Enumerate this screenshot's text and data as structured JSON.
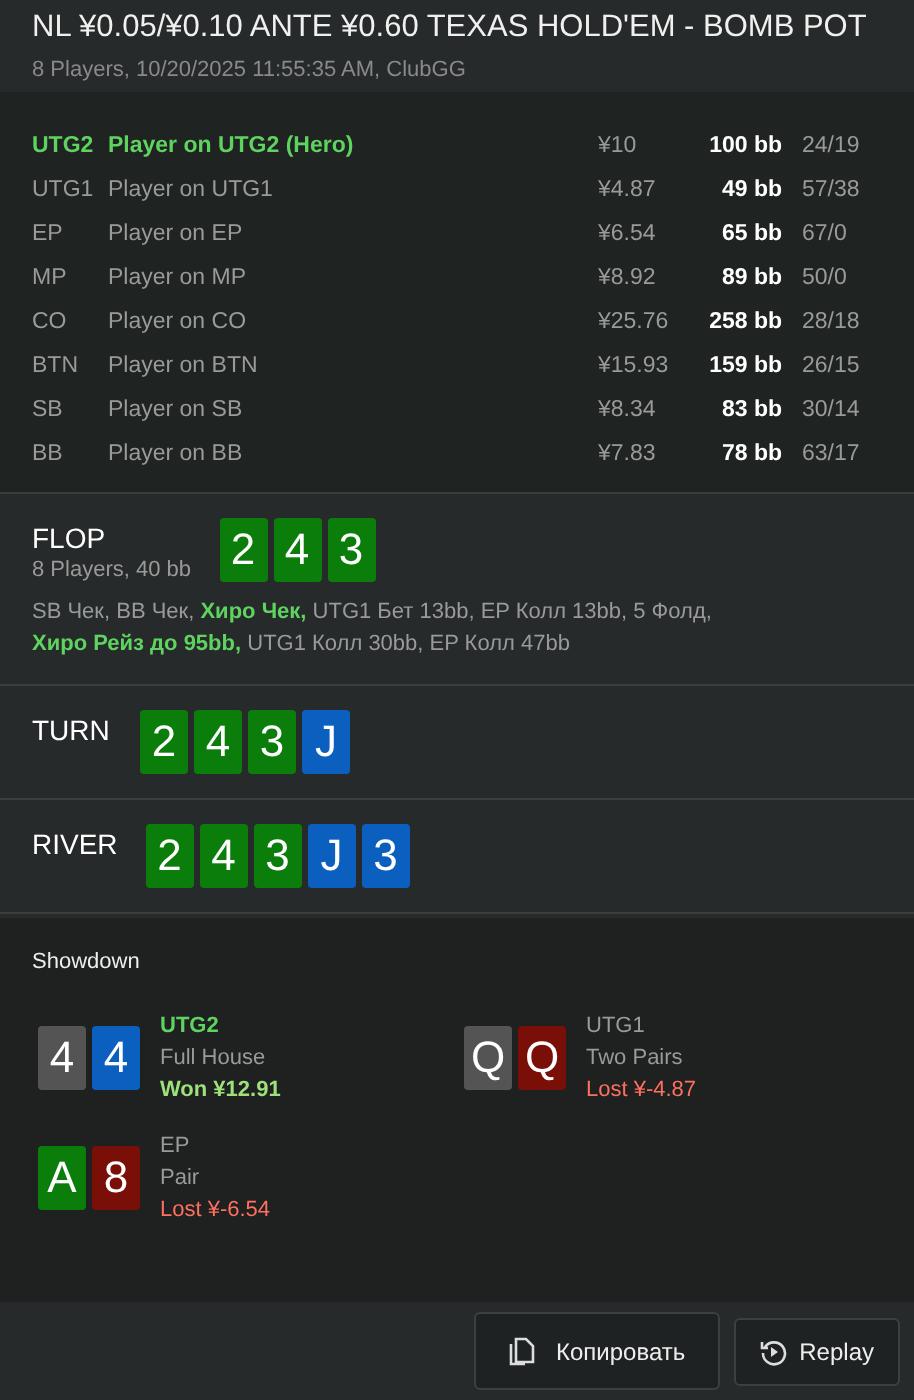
{
  "header": {
    "title": "NL ¥0.05/¥0.10 ANTE ¥0.60 TEXAS HOLD'EM - BOMB POT",
    "subtitle": "8 Players, 10/20/2025 11:55:35 AM, ClubGG"
  },
  "players": [
    {
      "position": "UTG2",
      "name": "Player on UTG2 (Hero)",
      "stack": "¥10",
      "bb": "100 bb",
      "stats": "24/19",
      "hero": true
    },
    {
      "position": "UTG1",
      "name": "Player on UTG1",
      "stack": "¥4.87",
      "bb": "49 bb",
      "stats": "57/38",
      "hero": false
    },
    {
      "position": "EP",
      "name": "Player on EP",
      "stack": "¥6.54",
      "bb": "65 bb",
      "stats": "67/0",
      "hero": false
    },
    {
      "position": "MP",
      "name": "Player on MP",
      "stack": "¥8.92",
      "bb": "89 bb",
      "stats": "50/0",
      "hero": false
    },
    {
      "position": "CO",
      "name": "Player on CO",
      "stack": "¥25.76",
      "bb": "258 bb",
      "stats": "28/18",
      "hero": false
    },
    {
      "position": "BTN",
      "name": "Player on BTN",
      "stack": "¥15.93",
      "bb": "159 bb",
      "stats": "26/15",
      "hero": false
    },
    {
      "position": "SB",
      "name": "Player on SB",
      "stack": "¥8.34",
      "bb": "83 bb",
      "stats": "30/14",
      "hero": false
    },
    {
      "position": "BB",
      "name": "Player on BB",
      "stack": "¥7.83",
      "bb": "78 bb",
      "stats": "63/17",
      "hero": false
    }
  ],
  "streets": [
    {
      "name": "FLOP",
      "info": "8 Players, 40 bb",
      "cards": [
        {
          "rank": "2",
          "color": "#0a7d0a"
        },
        {
          "rank": "4",
          "color": "#0a7d0a"
        },
        {
          "rank": "3",
          "color": "#0a7d0a"
        }
      ],
      "actions": "SB Чек, BB Чек, **Хиро Чек,** UTG1 Бет 13bb, EP Колл 13bb, 5 Фолд, **Хиро Рейз до 95bb,** UTG1 Колл 30bb, EP Колл 47bb"
    },
    {
      "name": "TURN",
      "cards": [
        {
          "rank": "2",
          "color": "#0a7d0a"
        },
        {
          "rank": "4",
          "color": "#0a7d0a"
        },
        {
          "rank": "3",
          "color": "#0a7d0a"
        },
        {
          "rank": "J",
          "color": "#0b5fbf"
        }
      ]
    },
    {
      "name": "RIVER",
      "cards": [
        {
          "rank": "2",
          "color": "#0a7d0a"
        },
        {
          "rank": "4",
          "color": "#0a7d0a"
        },
        {
          "rank": "3",
          "color": "#0a7d0a"
        },
        {
          "rank": "J",
          "color": "#0b5fbf"
        },
        {
          "rank": "3",
          "color": "#0b5fbf"
        }
      ]
    }
  ],
  "showdown": {
    "title": "Showdown",
    "hands": [
      {
        "cards": [
          {
            "rank": "4",
            "color": "#545454"
          },
          {
            "rank": "4",
            "color": "#0b5fbf"
          }
        ],
        "position": "UTG2",
        "hand": "Full House",
        "result": "Won ¥12.91",
        "kind": "won",
        "hero": true
      },
      {
        "cards": [
          {
            "rank": "Q",
            "color": "#545454"
          },
          {
            "rank": "Q",
            "color": "#7a0f08"
          }
        ],
        "position": "UTG1",
        "hand": "Two Pairs",
        "result": "Lost ¥-4.87",
        "kind": "lost",
        "hero": false
      },
      {
        "cards": [
          {
            "rank": "A",
            "color": "#0a7d0a"
          },
          {
            "rank": "8",
            "color": "#7a0f08"
          }
        ],
        "position": "EP",
        "hand": "Pair",
        "result": "Lost ¥-6.54",
        "kind": "lost",
        "hero": false
      }
    ]
  },
  "buttons": [
    {
      "label": "Копировать",
      "kind": "copy"
    },
    {
      "label": "Replay",
      "kind": "replay"
    }
  ]
}
